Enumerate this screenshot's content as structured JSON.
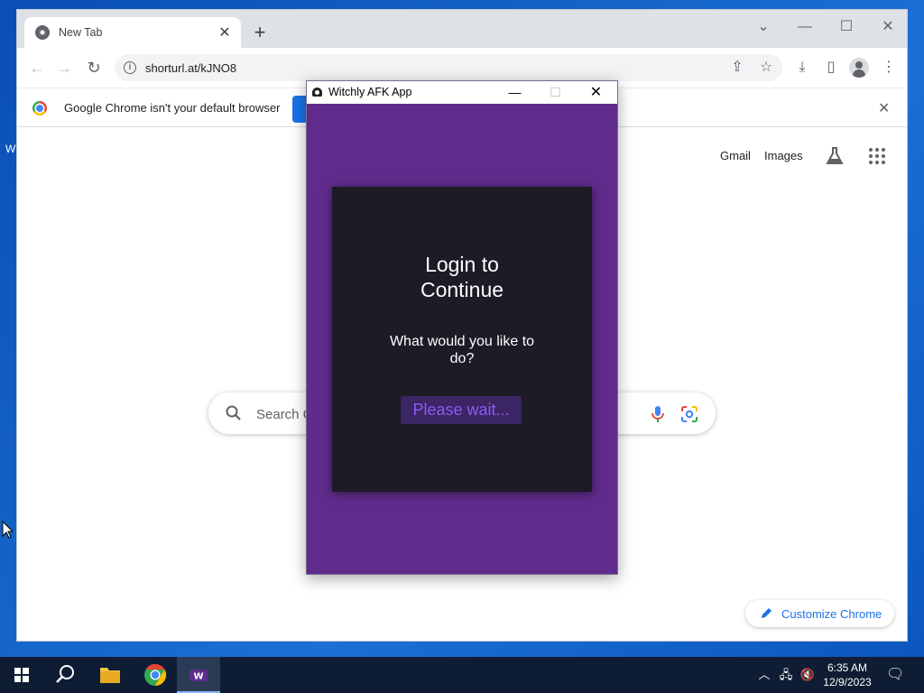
{
  "desktop": {
    "icon_label_fragment": "W"
  },
  "chrome": {
    "tab": {
      "title": "New Tab"
    },
    "new_tab_symbol": "+",
    "window_controls": {
      "tabsearch": "⌄",
      "minimize": "—",
      "maximize": "☐",
      "close": "✕"
    },
    "address_bar": {
      "url": "shorturl.at/kJNO8"
    },
    "infobar": {
      "message": "Google Chrome isn't your default browser"
    },
    "ntp": {
      "links": [
        "Gmail",
        "Images"
      ],
      "search_placeholder": "Search G",
      "customize_label": "Customize Chrome"
    }
  },
  "app": {
    "title": "Witchly AFK App",
    "heading": "Login to Continue",
    "question": "What would you like to do?",
    "button_label": "Please wait...",
    "colors": {
      "background": "#5f2c8c",
      "card": "#1c1b26",
      "button_bg": "#3b2563",
      "button_text": "#8b5cf6"
    }
  },
  "taskbar": {
    "clock": {
      "time": "6:35 AM",
      "date": "12/9/2023"
    }
  }
}
